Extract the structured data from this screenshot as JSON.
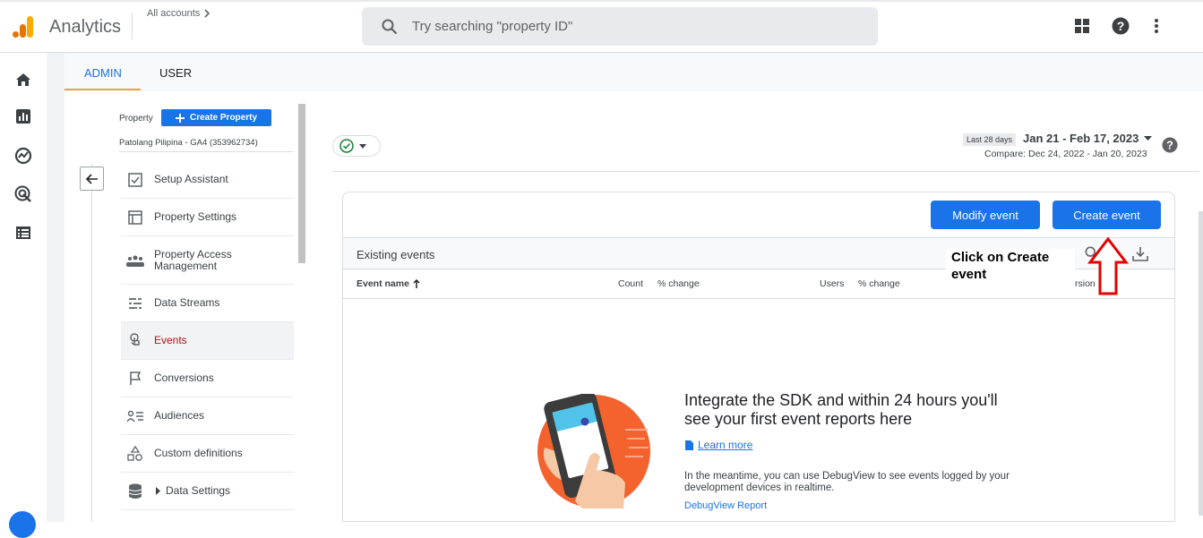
{
  "header": {
    "app_name": "Analytics",
    "all_accounts": "All accounts",
    "search_placeholder": "Try searching \"property ID\""
  },
  "tabs": [
    {
      "label": "ADMIN",
      "active": true
    },
    {
      "label": "USER",
      "active": false
    }
  ],
  "property": {
    "label": "Property",
    "create_button": "Create Property",
    "name": "Patolang Pilipina - GA4 (353962734)"
  },
  "nav": [
    {
      "label": "Setup Assistant",
      "icon": "checkbox-icon"
    },
    {
      "label": "Property Settings",
      "icon": "layout-icon"
    },
    {
      "label": "Property Access Management",
      "icon": "people-icon"
    },
    {
      "label": "Data Streams",
      "icon": "streams-icon"
    },
    {
      "label": "Events",
      "icon": "touch-icon",
      "active": true
    },
    {
      "label": "Conversions",
      "icon": "flag-icon"
    },
    {
      "label": "Audiences",
      "icon": "audience-icon"
    },
    {
      "label": "Custom definitions",
      "icon": "shapes-icon"
    },
    {
      "label": "Data Settings",
      "icon": "database-icon"
    }
  ],
  "date": {
    "preset": "Last 28 days",
    "range": "Jan 21 - Feb 17, 2023",
    "compare": "Compare: Dec 24, 2022 - Jan 20, 2023"
  },
  "buttons": {
    "modify_event": "Modify event",
    "create_event": "Create event"
  },
  "table": {
    "title": "Existing events",
    "columns": [
      "Event name",
      "Count",
      "% change",
      "Users",
      "% change",
      "rsion"
    ]
  },
  "annotation": "Click on Create event",
  "empty_state": {
    "title": "Integrate the SDK and within 24 hours you'll see your first event reports here",
    "learn_more": "Learn more",
    "meantime": "In the meantime, you can use DebugView to see events logged by your development devices in realtime.",
    "cut_link": "DebugView Report"
  },
  "colors": {
    "accent": "#1a73e8",
    "active_nav": "#b31412",
    "annotation_arrow": "#e60000",
    "illustration_orange": "#f4622e"
  }
}
